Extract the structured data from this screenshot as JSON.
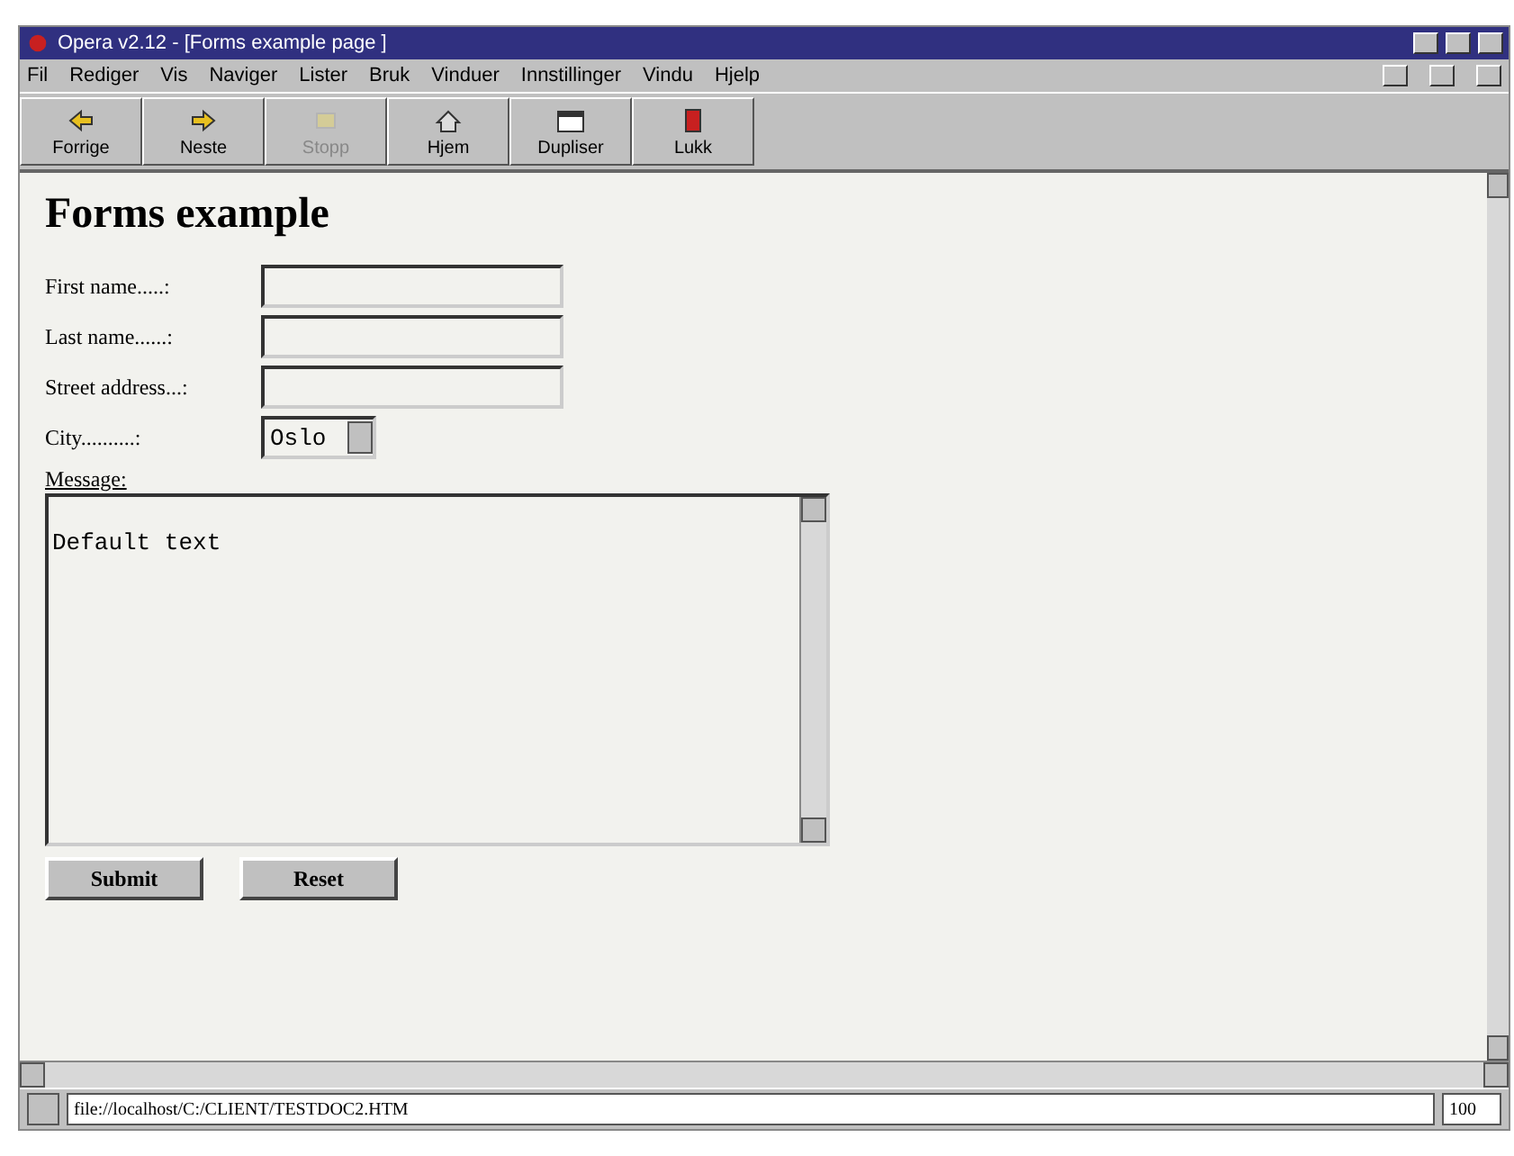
{
  "window": {
    "title": "Opera v2.12 - [Forms example page ]"
  },
  "menu": [
    "Fil",
    "Rediger",
    "Vis",
    "Naviger",
    "Lister",
    "Bruk",
    "Vinduer",
    "Innstillinger",
    "Vindu",
    "Hjelp"
  ],
  "toolbar": [
    {
      "label": "Forrige",
      "kind": "back",
      "disabled": false
    },
    {
      "label": "Neste",
      "kind": "forward",
      "disabled": false
    },
    {
      "label": "Stopp",
      "kind": "stop",
      "disabled": true
    },
    {
      "label": "Hjem",
      "kind": "home",
      "disabled": false
    },
    {
      "label": "Dupliser",
      "kind": "duplicate",
      "disabled": false
    },
    {
      "label": "Lukk",
      "kind": "close",
      "disabled": false
    }
  ],
  "page": {
    "heading": "Forms example",
    "fields": [
      {
        "kind": "text",
        "label": "First name.....:"
      },
      {
        "kind": "text",
        "label": "Last name......:"
      },
      {
        "kind": "text",
        "label": "Street address...:"
      },
      {
        "kind": "select",
        "label": "City..........:",
        "value": "Oslo"
      }
    ],
    "message_label": "Message:",
    "message_value": "Default text",
    "buttons": [
      "Submit",
      "Reset"
    ]
  },
  "status_bar": {
    "url": "file://localhost/C:/CLIENT/TESTDOC2.HTM",
    "zoom": "100"
  }
}
